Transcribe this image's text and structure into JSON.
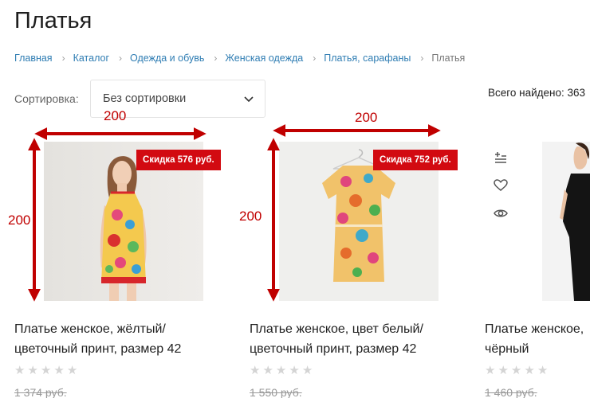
{
  "page": {
    "title": "Платья"
  },
  "breadcrumbs": [
    {
      "label": "Главная"
    },
    {
      "label": "Каталог"
    },
    {
      "label": "Одежда и обувь"
    },
    {
      "label": "Женская одежда"
    },
    {
      "label": "Платья, сарафаны"
    },
    {
      "label": "Платья"
    }
  ],
  "sort": {
    "label": "Сортировка:",
    "selected": "Без сортировки"
  },
  "total_found": "Всего найдено: 363",
  "products": [
    {
      "title_line1": "Платье женское, жёлтый/",
      "title_line2": "цветочный принт, размер 42",
      "badge": "Скидка 576 руб.",
      "old_price": "1 374 руб.",
      "rating": 0,
      "image_icon": "woman-in-floral-dress-photo"
    },
    {
      "title_line1": "Платье женское, цвет белый/",
      "title_line2": "цветочный принт, размер 42",
      "badge": "Скидка 752 руб.",
      "old_price": "1 550 руб.",
      "rating": 0,
      "image_icon": "floral-dress-on-hanger-photo"
    },
    {
      "title_line1": "Платье женское,",
      "title_line2": "чёрный",
      "old_price": "1 460 руб.",
      "rating": 0,
      "image_icon": "woman-in-black-dress-photo"
    }
  ],
  "card_actions": [
    "add-to-compare-icon",
    "heart-icon",
    "eye-icon"
  ],
  "annotations": {
    "width_label_1": "200",
    "height_label_1": "200",
    "width_label_2": "200",
    "height_label_2": "200"
  },
  "colors": {
    "badge": "#d20a11",
    "link": "#2f7db3",
    "annotation": "#c00000"
  }
}
